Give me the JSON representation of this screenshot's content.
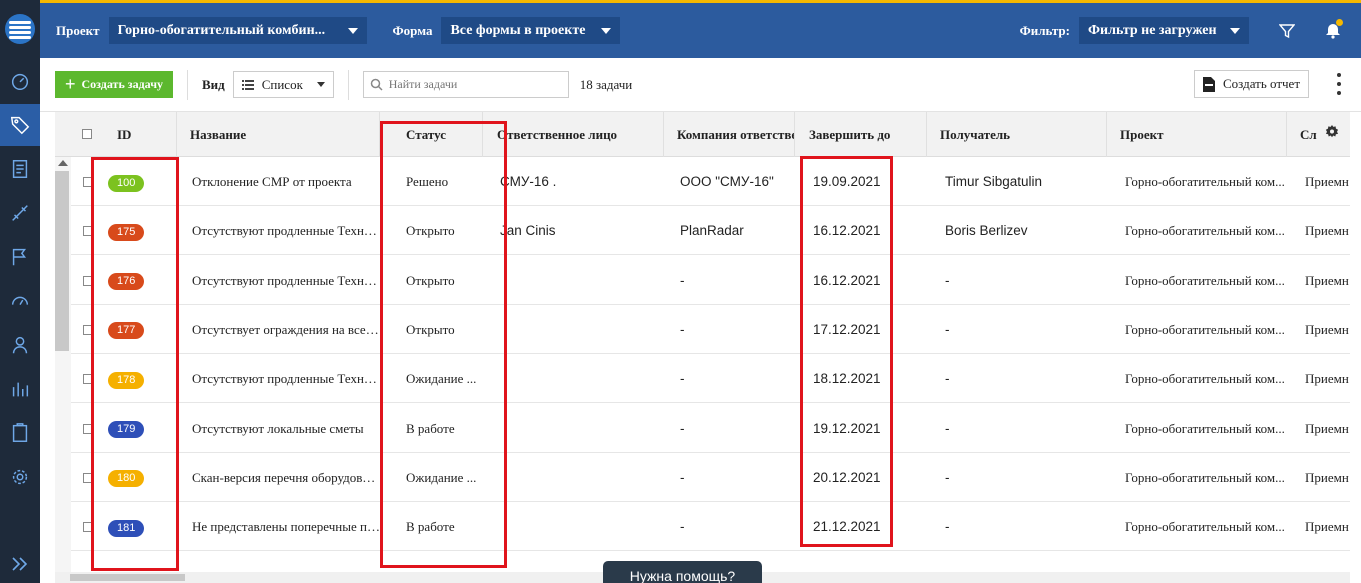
{
  "header": {
    "project_label": "Проект",
    "project_value": "Горно-обогатительный комбин...",
    "form_label": "Форма",
    "form_value": "Все формы в проекте",
    "filter_label": "Фильтр:",
    "filter_value": "Фильтр не загружен"
  },
  "toolbar": {
    "create_task": "Создать задачу",
    "view_label": "Вид",
    "view_value": "Список",
    "search_placeholder": "Найти задачи",
    "task_count": "18 задачи",
    "report_button": "Создать отчет"
  },
  "table": {
    "columns": {
      "id": "ID",
      "name": "Название",
      "status": "Статус",
      "responsible": "Ответственное лицо",
      "company": "Компания ответственного",
      "due": "Завершить до",
      "recipient": "Получатель",
      "project": "Проект",
      "next": "Сл"
    },
    "rows": [
      {
        "id": "100",
        "badge_color": "#7cc21f",
        "name": "Отклонение СМР от проекта",
        "status": "Решено",
        "responsible": "СМУ-16 .",
        "company": "ООО \"СМУ-16\"",
        "due": "19.09.2021",
        "recipient": "Timur Sibgatulin",
        "project": "Горно-обогатительный ком...",
        "next": "Приемн"
      },
      {
        "id": "175",
        "badge_color": "#d84a1b",
        "name": "Отсутствуют продленные Технич...",
        "status": "Открыто",
        "responsible": "Jan Cinis",
        "company": "PlanRadar",
        "due": "16.12.2021",
        "recipient": "Boris Berlizev",
        "project": "Горно-обогатительный ком...",
        "next": "Приемн"
      },
      {
        "id": "176",
        "badge_color": "#d84a1b",
        "name": "Отсутствуют продленные Технич...",
        "status": "Открыто",
        "responsible": "",
        "company": "-",
        "due": "16.12.2021",
        "recipient": "-",
        "project": "Горно-обогатительный ком...",
        "next": "Приемн"
      },
      {
        "id": "177",
        "badge_color": "#d84a1b",
        "name": "Отсутствует ограждения на всем ...",
        "status": "Открыто",
        "responsible": "",
        "company": "-",
        "due": "17.12.2021",
        "recipient": "-",
        "project": "Горно-обогатительный ком...",
        "next": "Приемн"
      },
      {
        "id": "178",
        "badge_color": "#f5b000",
        "name": "Отсутствуют продленные Технич...",
        "status": "Ожидание ...",
        "responsible": "",
        "company": "-",
        "due": "18.12.2021",
        "recipient": "-",
        "project": "Горно-обогатительный ком...",
        "next": "Приемн"
      },
      {
        "id": "179",
        "badge_color": "#2e4fb8",
        "name": "Отсутствуют локальные сметы",
        "status": "В работе",
        "responsible": "",
        "company": "-",
        "due": "19.12.2021",
        "recipient": "-",
        "project": "Горно-обогатительный ком...",
        "next": "Приемн"
      },
      {
        "id": "180",
        "badge_color": "#f5b000",
        "name": "Скан-версия перечня оборудования",
        "status": "Ожидание ...",
        "responsible": "",
        "company": "-",
        "due": "20.12.2021",
        "recipient": "-",
        "project": "Горно-обогатительный ком...",
        "next": "Приемн"
      },
      {
        "id": "181",
        "badge_color": "#2e4fb8",
        "name": "Не представлены поперечные про...",
        "status": "В работе",
        "responsible": "",
        "company": "-",
        "due": "21.12.2021",
        "recipient": "-",
        "project": "Горно-обогатительный ком...",
        "next": "Приемн"
      }
    ]
  },
  "help_button": "Нужна помощь?",
  "colors": {
    "header_bg": "#2c5b9e",
    "accent_top": "#f5b800",
    "nav_bg": "#1e2a3a",
    "create_button": "#5cb82e",
    "highlight": "#e0141c"
  }
}
